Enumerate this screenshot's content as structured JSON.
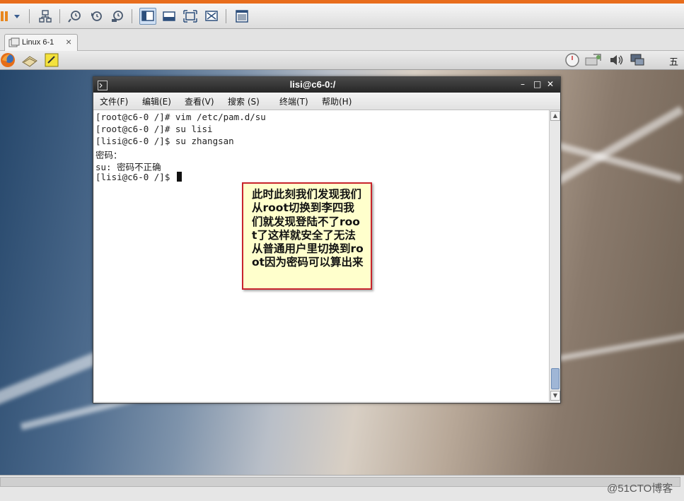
{
  "toolbar": {
    "buttons": [
      "pause-icon",
      "dropdown-icon",
      "network-icon",
      "snapshot-icon",
      "revert-snapshot-icon",
      "snapshot-manager-icon",
      "normal-view-icon",
      "quick-switch-icon",
      "fullscreen-icon",
      "unity-icon",
      "console-view-icon"
    ]
  },
  "vm_tab": {
    "label": "Linux 6-1",
    "close": "×"
  },
  "panel": {
    "clock_text": "五"
  },
  "terminal": {
    "title": "lisi@c6-0:/",
    "controls": {
      "minimize": "–",
      "maximize": "□",
      "close": "✕"
    },
    "menu": [
      "文件(F)",
      "编辑(E)",
      "查看(V)",
      "搜索 (S)",
      "终端(T)",
      "帮助(H)"
    ],
    "lines": [
      "[root@c6-0 /]# vim /etc/pam.d/su",
      "[root@c6-0 /]# su lisi",
      "[lisi@c6-0 /]$ su zhangsan",
      "密码：",
      "su: 密码不正确",
      "[lisi@c6-0 /]$ "
    ]
  },
  "note": {
    "text": "此时此刻我们发现我们从root切换到李四我们就发现登陆不了root了这样就安全了无法从普通用户里切换到root因为密码可以算出来"
  },
  "watermark": "@51CTO博客",
  "colors": {
    "accent_orange": "#e86d1c",
    "note_bg": "#ffffcc",
    "note_border": "#c8242c",
    "titlebar": "#2f2f2f"
  }
}
